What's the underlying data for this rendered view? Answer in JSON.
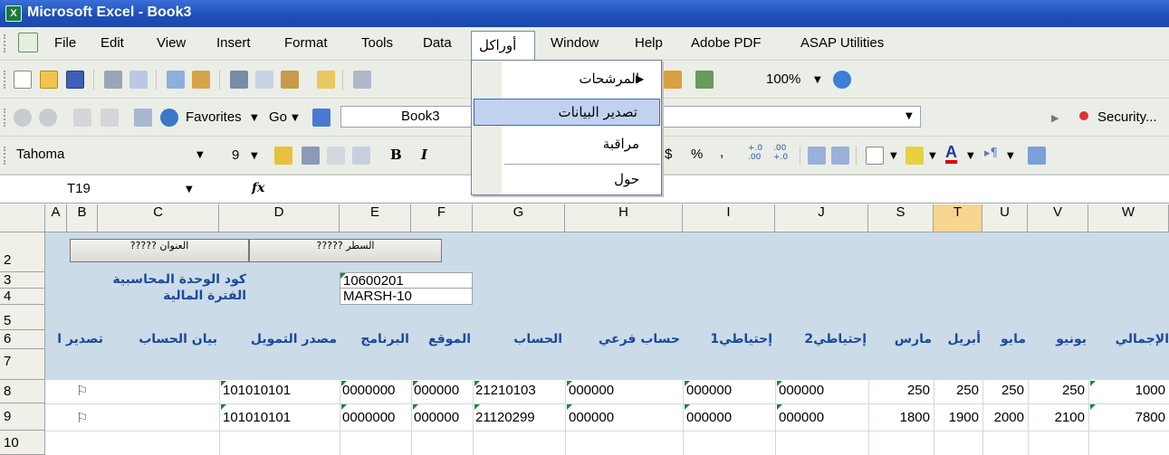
{
  "window": {
    "title": "Microsoft Excel - Book3"
  },
  "menubar": {
    "items": [
      "File",
      "Edit",
      "View",
      "Insert",
      "Format",
      "Tools",
      "Data",
      "أوراكل",
      "Window",
      "Help",
      "Adobe PDF",
      "ASAP Utilities"
    ],
    "active": "أوراكل"
  },
  "dropdown": {
    "items": [
      "المرشحات",
      "تصدير البيانات",
      "مراقبة",
      "حول"
    ],
    "highlighted": "تصدير البيانات",
    "submenu_arrow": "▶"
  },
  "toolbar_standard": {
    "zoom": "100%"
  },
  "toolbar_web": {
    "favorites": "Favorites",
    "go": "Go",
    "address": "Book3",
    "security": "Security..."
  },
  "toolbar_format": {
    "font": "Tahoma",
    "size": "9",
    "bold": "B",
    "italic": "I",
    "currency": "$",
    "percent": "%",
    "comma": ",",
    "inc_dec": "+.0\n.00",
    "dec_dec": ".00\n+.0"
  },
  "formula_bar": {
    "name_box": "T19",
    "fx": "fx",
    "content": ""
  },
  "columns": [
    "A",
    "B",
    "C",
    "D",
    "E",
    "F",
    "G",
    "H",
    "I",
    "J",
    "S",
    "T",
    "U",
    "V",
    "W"
  ],
  "selected_column": "T",
  "rows": [
    "2",
    "3",
    "4",
    "5",
    "6",
    "7",
    "8",
    "9",
    "10"
  ],
  "sheet": {
    "buttons": [
      "العنوان ?????",
      "السطر ?????"
    ],
    "labels": {
      "r3": "كود الوحدة المحاسبية",
      "r4": "الفترة المالية"
    },
    "values": {
      "r3": "10600201",
      "r4": "MARSH-10"
    },
    "headers": [
      "تصدير ا",
      "بيان الحساب",
      "مصدر التمويل",
      "البرنامج",
      "الموقع",
      "الحساب",
      "حساب فرعي",
      "إحتياطي1",
      "إحتياطي2",
      "مارس",
      "أبريل",
      "مايو",
      "يونيو",
      "الإجمالي"
    ],
    "row8": {
      "flag": "⚐",
      "d": "101010101",
      "e": "0000000",
      "f": "000000",
      "g": "21210103",
      "h": "000000",
      "i": "000000",
      "j": "000000",
      "s": "250",
      "t": "250",
      "u": "250",
      "v": "250",
      "w": "1000"
    },
    "row9": {
      "flag": "⚐",
      "d": "101010101",
      "e": "0000000",
      "f": "000000",
      "g": "21120299",
      "h": "000000",
      "i": "000000",
      "j": "000000",
      "s": "1800",
      "t": "1900",
      "u": "2000",
      "v": "2100",
      "w": "7800"
    }
  },
  "colors": {
    "header_band": "#ccdbe8",
    "highlight": "#c1d2ee",
    "selected_col": "#f8d58f"
  }
}
